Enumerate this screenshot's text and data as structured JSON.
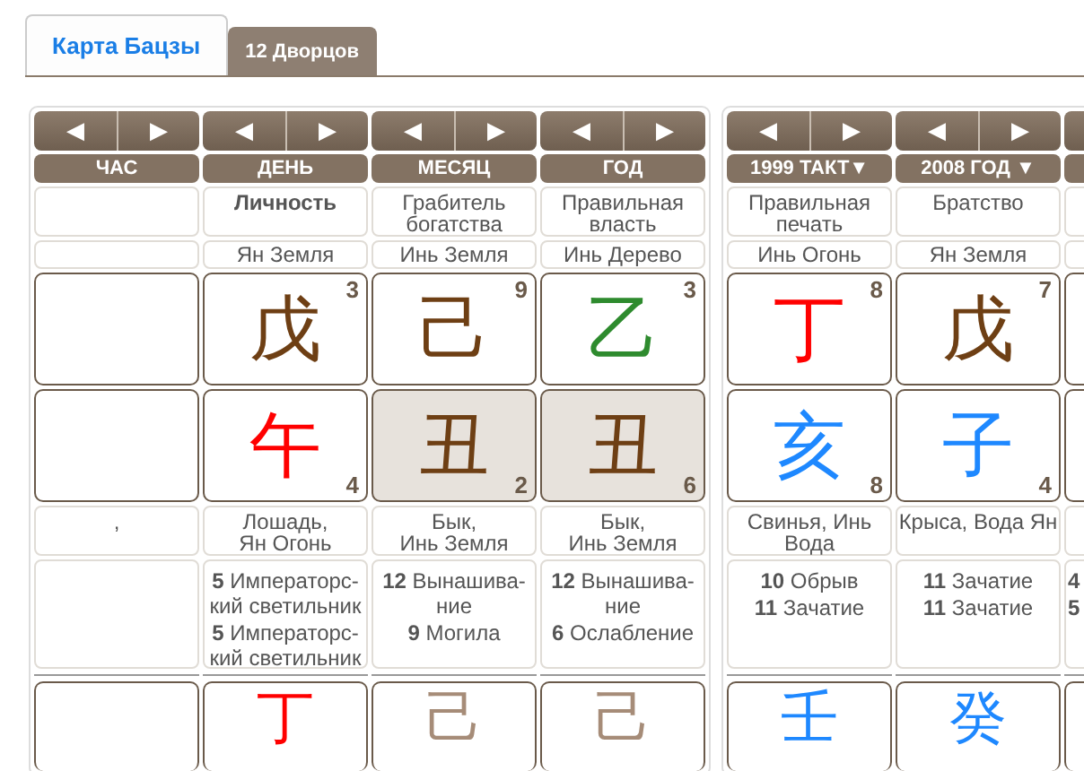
{
  "tabs": [
    {
      "label": "Карта Бацзы",
      "selected": true
    },
    {
      "label": "12 Дворцов",
      "selected": false
    }
  ],
  "panels": [
    {
      "columns": [
        {
          "nav": [
            "◀",
            "▶"
          ],
          "header": "ЧАС",
          "branch_desc": ","
        },
        {
          "nav": [
            "◀",
            "▶"
          ],
          "header": "ДЕНЬ",
          "ten_god": "Личность",
          "ten_god_bold": true,
          "element": "Ян Земля",
          "stem": {
            "char": "戊",
            "color": "#6e3f14",
            "number": "3"
          },
          "branch": {
            "char": "午",
            "color": "#ff0000",
            "number": "4",
            "highlighted": false
          },
          "branch_desc": "Лошадь,\nЯн Огонь",
          "strength": [
            {
              "num": "5",
              "text": "Императорс-кий светильник"
            },
            {
              "num": "5",
              "text": "Императорс-кий светильник"
            }
          ],
          "lower_stem": {
            "char": "丁",
            "color": "#ff0000"
          }
        },
        {
          "nav": [
            "◀",
            "▶"
          ],
          "header": "МЕСЯЦ",
          "ten_god": "Грабитель богатства",
          "ten_god_bold": false,
          "element": "Инь Земля",
          "stem": {
            "char": "己",
            "color": "#6e3f14",
            "number": "9"
          },
          "branch": {
            "char": "丑",
            "color": "#6e3f14",
            "number": "2",
            "highlighted": true
          },
          "branch_desc": "Бык,\nИнь Земля",
          "strength": [
            {
              "num": "12",
              "text": "Вынашива-ние"
            },
            {
              "num": "9",
              "text": "Могила"
            }
          ],
          "lower_stem": {
            "char": "己",
            "color": "#a68c78"
          }
        },
        {
          "nav": [
            "◀",
            "▶"
          ],
          "header": "ГОД",
          "ten_god": "Правильная власть",
          "ten_god_bold": false,
          "element": "Инь Дерево",
          "stem": {
            "char": "乙",
            "color": "#2e8b2e",
            "number": "3"
          },
          "branch": {
            "char": "丑",
            "color": "#6e3f14",
            "number": "6",
            "highlighted": true
          },
          "branch_desc": "Бык,\nИнь Земля",
          "strength": [
            {
              "num": "12",
              "text": "Вынашива-ние"
            },
            {
              "num": "6",
              "text": "Ослабление"
            }
          ],
          "lower_stem": {
            "char": "己",
            "color": "#a68c78"
          }
        }
      ]
    },
    {
      "columns": [
        {
          "nav": [
            "◀",
            "▶"
          ],
          "header": "1999 ТАКТ▼",
          "ten_god": "Правильная печать",
          "ten_god_bold": false,
          "element": "Инь Огонь",
          "stem": {
            "char": "丁",
            "color": "#ff0000",
            "number": "8"
          },
          "branch": {
            "char": "亥",
            "color": "#1e88ff",
            "number": "8",
            "highlighted": false
          },
          "branch_desc": "Свинья, Инь Вода",
          "strength": [
            {
              "num": "10",
              "text": "Обрыв"
            },
            {
              "num": "11",
              "text": "Зачатие"
            }
          ],
          "lower_stem": {
            "char": "壬",
            "color": "#1e88ff"
          }
        },
        {
          "nav": [
            "◀",
            "▶"
          ],
          "header": "2008 ГОД ▼",
          "ten_god": "Братство",
          "ten_god_bold": false,
          "element": "Ян Земля",
          "stem": {
            "char": "戊",
            "color": "#6e3f14",
            "number": "7"
          },
          "branch": {
            "char": "子",
            "color": "#1e88ff",
            "number": "4",
            "highlighted": false
          },
          "branch_desc": "Крыса, Вода Ян",
          "strength": [
            {
              "num": "11",
              "text": "Зачатие"
            },
            {
              "num": "11",
              "text": "Зачатие"
            }
          ],
          "lower_stem": {
            "char": "癸",
            "color": "#1e88ff"
          }
        },
        {
          "strength": [
            {
              "num": "4"
            },
            {
              "num": "5"
            }
          ]
        }
      ]
    }
  ]
}
